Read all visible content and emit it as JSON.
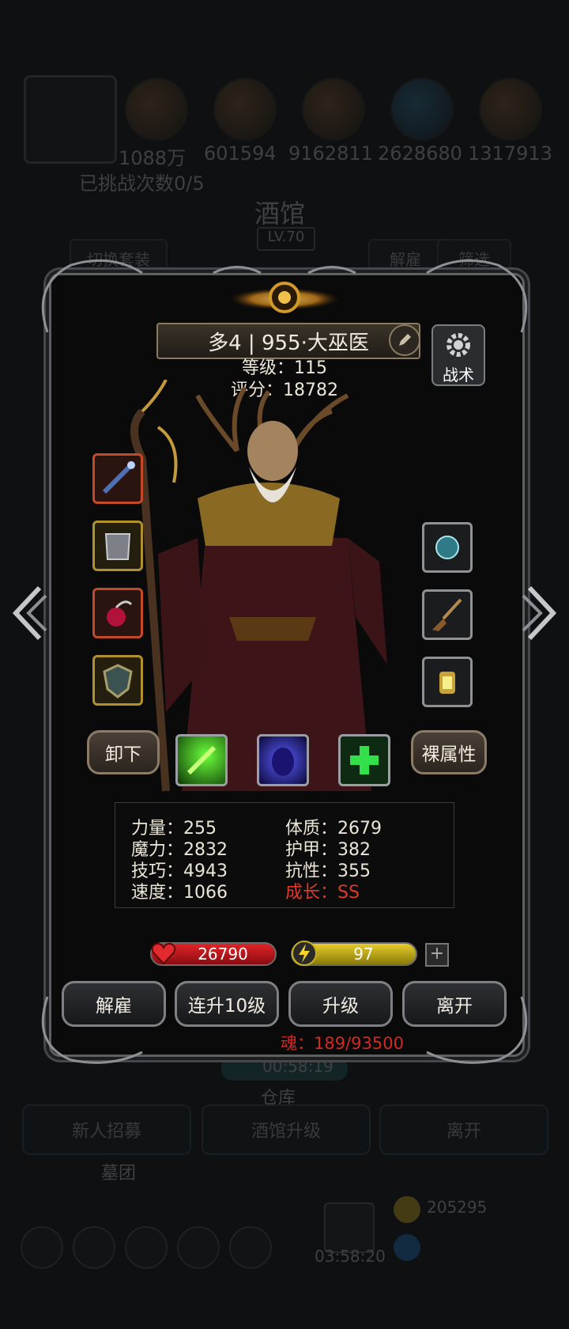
{
  "background": {
    "resources": [
      "1088万",
      "601594",
      "9162811",
      "2628680",
      "1317913"
    ],
    "challenge_text": "已挑战次数0/5",
    "title": "酒馆",
    "level": "LV.70",
    "switch_outfit_label": "切换套装",
    "dismiss_label": "解雇",
    "filter_label": "筛选",
    "timer": "00:58:19",
    "warehouse_label": "仓库",
    "recruit_label": "新人招募",
    "upgrade_tavern_label": "酒馆升级",
    "leave_label": "离开",
    "guild_label": "墓团",
    "countdown": "03:58:20",
    "gold": "205295"
  },
  "hero": {
    "name": "多4 | 955·大巫医",
    "level_text": "等级：115",
    "score_text": "评分：18782",
    "tactics_label": "战术",
    "unequip_label": "卸下",
    "base_attr_label": "裸属性"
  },
  "stats": {
    "strength": "力量：255",
    "magic": "魔力：2832",
    "skill": "技巧：4943",
    "speed": "速度：1066",
    "constitution": "体质：2679",
    "armor": "护甲：382",
    "resistance": "抗性：355",
    "growth": "成长：SS"
  },
  "bars": {
    "hp": "26790",
    "energy": "97",
    "plus": "+"
  },
  "actions": {
    "dismiss": "解雇",
    "level_up_10": "连升10级",
    "level_up": "升级",
    "leave": "离开"
  },
  "soul_text": "魂：189/93500",
  "colors": {
    "growth": "#e0392a",
    "soul": "#d12a22",
    "hp_bar": "#c0181c",
    "energy_bar": "#c9b019"
  }
}
